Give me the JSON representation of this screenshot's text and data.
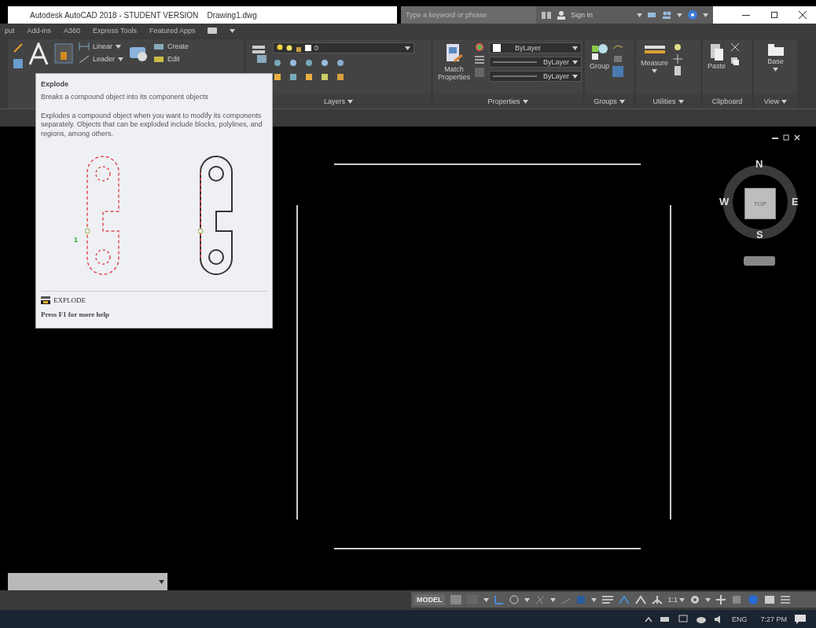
{
  "title_bar": {
    "title": "Autodesk AutoCAD 2018 - STUDENT VERSION    Drawing1.dwg",
    "search": {
      "placeholder": "Type a keyword or phrase"
    },
    "sign_in": "Sign In"
  },
  "ribbon_tabs": [
    "put",
    "Add-ins",
    "A360",
    "Express Tools",
    "Featured Apps"
  ],
  "ribbon": {
    "linear": "Linear",
    "leader": "Leader",
    "create": "Create",
    "edit": "Edit",
    "current_layer": "0",
    "layers_label": "Layers",
    "match_properties": "Match Properties",
    "color_setting": "ByLayer",
    "linetype": "ByLayer",
    "lineweight": "ByLayer",
    "properties_label": "Properties",
    "group": "Group",
    "groups_label": "Groups",
    "measure": "Measure",
    "utilities_label": "Utilities",
    "paste": "Paste",
    "clipboard_label": "Clipboard",
    "base": "Base",
    "view_label": "View"
  },
  "tooltip": {
    "title": "Explode",
    "summary": "Breaks a compound object into its component objects",
    "description": "Explodes a compound object when you want to modify its components separately. Objects that can be exploded include blocks, polylines, and regions, among others.",
    "callout": "1",
    "command": "EXPLODE",
    "help": "Press F1 for more help"
  },
  "viewcube": {
    "north": "N",
    "west": "W",
    "east": "E",
    "south": "S",
    "face": "TOP"
  },
  "status_bar": {
    "model": "MODEL",
    "scale": "1:1"
  },
  "taskbar": {
    "language": "ENG",
    "time": "7:27 PM"
  }
}
